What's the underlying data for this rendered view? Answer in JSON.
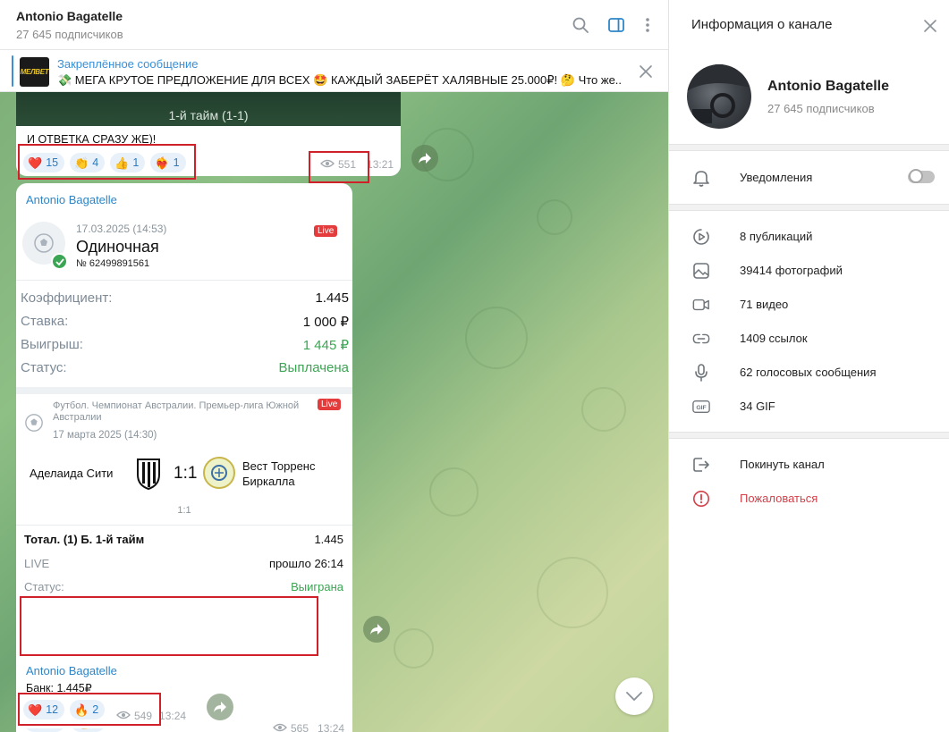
{
  "chat": {
    "title": "Antonio Bagatelle",
    "subscribers": "27 645 подписчиков"
  },
  "pinned": {
    "title": "Закреплённое сообщение",
    "thumb_text": "МЕЛBET",
    "text": "💸 МЕГА КРУТОЕ ПРЕДЛОЖЕНИЕ ДЛЯ ВСЕХ 🤩 КАЖДЫЙ ЗАБЕРЁТ ХАЛЯВНЫЕ 25.000₽! 🤔 Что же..."
  },
  "messages": [
    {
      "banner": "1-й тайм (1-1)",
      "text": "И ОТВЕТКА СРАЗУ ЖЕ)!",
      "reactions": [
        {
          "emoji": "❤️",
          "count": "15"
        },
        {
          "emoji": "👏",
          "count": "4"
        },
        {
          "emoji": "👍",
          "count": "1"
        },
        {
          "emoji": "❤️‍🔥",
          "count": "1"
        }
      ],
      "views": "551",
      "time": "13:21"
    },
    {
      "sender": "Antonio Bagatelle",
      "bet": {
        "date": "17.03.2025 (14:53)",
        "type": "Одиночная",
        "number": "№ 62499891561",
        "live": "Live",
        "rows": [
          {
            "label": "Коэффициент:",
            "value": "1.445"
          },
          {
            "label": "Ставка:",
            "value": "1 000 ₽"
          },
          {
            "label": "Выигрыш:",
            "value": "1 445 ₽"
          },
          {
            "label": "Статус:",
            "value": "Выплачена"
          }
        ]
      },
      "match": {
        "league": "Футбол. Чемпионат Австралии. Премьер-лига Южной Австралии",
        "date": "17 марта 2025 (14:30)",
        "live": "Live",
        "home": "Аделаида Сити",
        "score": "1:1",
        "away": "Вест Торренс Биркалла",
        "halftime": "1:1",
        "market": "Тотал. (1) Б. 1-й тайм",
        "coef": "1.445",
        "live_label": "LIVE",
        "elapsed": "прошло 26:14",
        "status_label": "Статус:",
        "status": "Выиграна"
      },
      "checks": "✅✅✅✅✅✅✅",
      "reactions": [
        {
          "emoji": "❤️",
          "count": "13"
        },
        {
          "emoji": "👍",
          "count": "1"
        }
      ],
      "views": "565",
      "time": "13:24"
    },
    {
      "sender": "Antonio Bagatelle",
      "text": "Банк: 1.445₽",
      "reactions": [
        {
          "emoji": "❤️",
          "count": "12"
        },
        {
          "emoji": "🔥",
          "count": "2"
        }
      ],
      "views": "549",
      "time": "13:24"
    }
  ],
  "info": {
    "title": "Информация о канале",
    "name": "Antonio Bagatelle",
    "subscribers": "27 645 подписчиков",
    "notifications": "Уведомления",
    "notifications_on": false,
    "media": [
      {
        "icon": "publications-icon",
        "label": "8 публикаций"
      },
      {
        "icon": "photo-icon",
        "label": "39414 фотографий"
      },
      {
        "icon": "video-icon",
        "label": "71 видео"
      },
      {
        "icon": "link-icon",
        "label": "1409 ссылок"
      },
      {
        "icon": "microphone-icon",
        "label": "62 голосовых сообщения"
      },
      {
        "icon": "gif-icon",
        "label": "34 GIF"
      }
    ],
    "leave": "Покинуть канал",
    "report": "Пожаловаться"
  },
  "colors": {
    "accent": "#2e86c8",
    "green": "#3aa552",
    "red": "#d0202a",
    "report": "#d2404a"
  }
}
